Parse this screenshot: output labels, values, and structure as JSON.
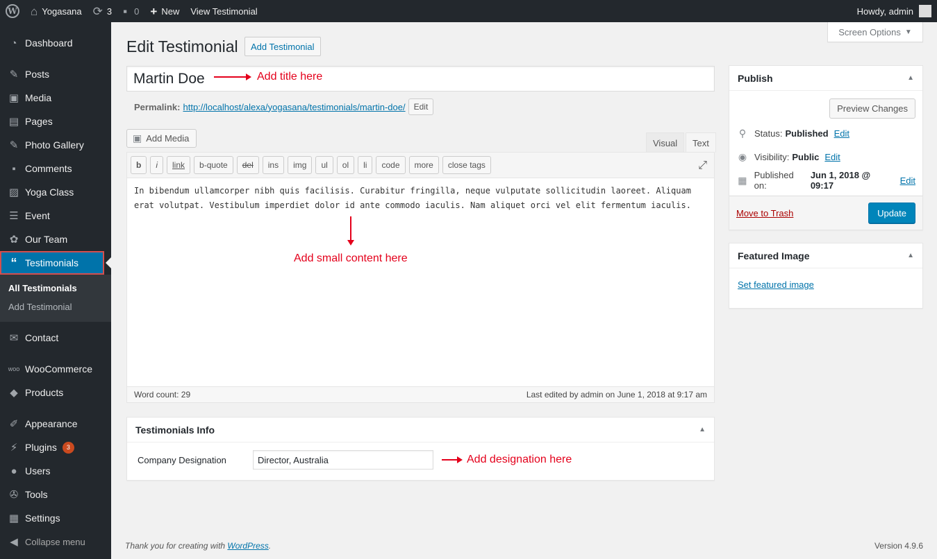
{
  "adminbar": {
    "site_name": "Yogasana",
    "updates_count": "3",
    "comments_count": "0",
    "new_label": "New",
    "view_label": "View Testimonial",
    "howdy": "Howdy, admin"
  },
  "sidebar": {
    "items": [
      {
        "label": "Dashboard",
        "icon": "dashboard-icon"
      },
      {
        "label": "Posts",
        "icon": "pin-icon"
      },
      {
        "label": "Media",
        "icon": "media-icon"
      },
      {
        "label": "Pages",
        "icon": "pages-icon"
      },
      {
        "label": "Photo Gallery",
        "icon": "pin-icon"
      },
      {
        "label": "Comments",
        "icon": "comments-icon"
      },
      {
        "label": "Yoga Class",
        "icon": "image-icon"
      },
      {
        "label": "Event",
        "icon": "event-icon"
      },
      {
        "label": "Our Team",
        "icon": "team-icon"
      },
      {
        "label": "Testimonials",
        "icon": "quote-icon"
      }
    ],
    "submenu": [
      "All Testimonials",
      "Add Testimonial"
    ],
    "items2": [
      {
        "label": "Contact",
        "icon": "mail-icon"
      },
      {
        "label": "WooCommerce",
        "icon": "woo-icon"
      },
      {
        "label": "Products",
        "icon": "products-icon"
      },
      {
        "label": "Appearance",
        "icon": "brush-icon"
      },
      {
        "label": "Plugins",
        "icon": "plug-icon",
        "badge": "3"
      },
      {
        "label": "Users",
        "icon": "user-icon"
      },
      {
        "label": "Tools",
        "icon": "wrench-icon"
      },
      {
        "label": "Settings",
        "icon": "settings-icon"
      },
      {
        "label": "Collapse menu",
        "icon": "collapse-icon"
      }
    ]
  },
  "main": {
    "screen_options": "Screen Options",
    "page_title": "Edit Testimonial",
    "add_new": "Add Testimonial",
    "post_title": "Martin Doe",
    "title_annotation": "Add title here",
    "permalink_label": "Permalink:",
    "permalink_url": "http://localhost/alexa/yogasana/testimonials/martin-doe/",
    "permalink_edit": "Edit",
    "add_media": "Add Media",
    "tab_visual": "Visual",
    "tab_text": "Text",
    "quicktags": [
      "b",
      "i",
      "link",
      "b-quote",
      "del",
      "ins",
      "img",
      "ul",
      "ol",
      "li",
      "code",
      "more",
      "close tags"
    ],
    "content": "In bibendum ullamcorper nibh quis facilisis. Curabitur fringilla, neque vulputate sollicitudin laoreet. Aliquam erat volutpat. Vestibulum imperdiet dolor id ante commodo iaculis. Nam aliquet orci vel elit fermentum iaculis.",
    "content_annotation": "Add small content here",
    "word_count": "Word count: 29",
    "last_edited": "Last edited by admin on June 1, 2018 at 9:17 am"
  },
  "testimonials_info": {
    "title": "Testimonials Info",
    "label": "Company Designation",
    "value": "Director, Australia",
    "annotation": "Add designation here"
  },
  "publish": {
    "title": "Publish",
    "preview": "Preview Changes",
    "status_label": "Status:",
    "status_value": "Published",
    "visibility_label": "Visibility:",
    "visibility_value": "Public",
    "published_label": "Published on:",
    "published_value": "Jun 1, 2018 @ 09:17",
    "edit": "Edit",
    "trash": "Move to Trash",
    "update": "Update"
  },
  "featured": {
    "title": "Featured Image",
    "link": "Set featured image"
  },
  "footer": {
    "thanks_prefix": "Thank you for creating with ",
    "wp_link": "WordPress",
    "thanks_suffix": ".",
    "version": "Version 4.9.6"
  },
  "colors": {
    "adminbar_bg": "#23282d",
    "accent": "#0073aa",
    "primary_button": "#0085ba",
    "annotation": "#e4001b"
  }
}
